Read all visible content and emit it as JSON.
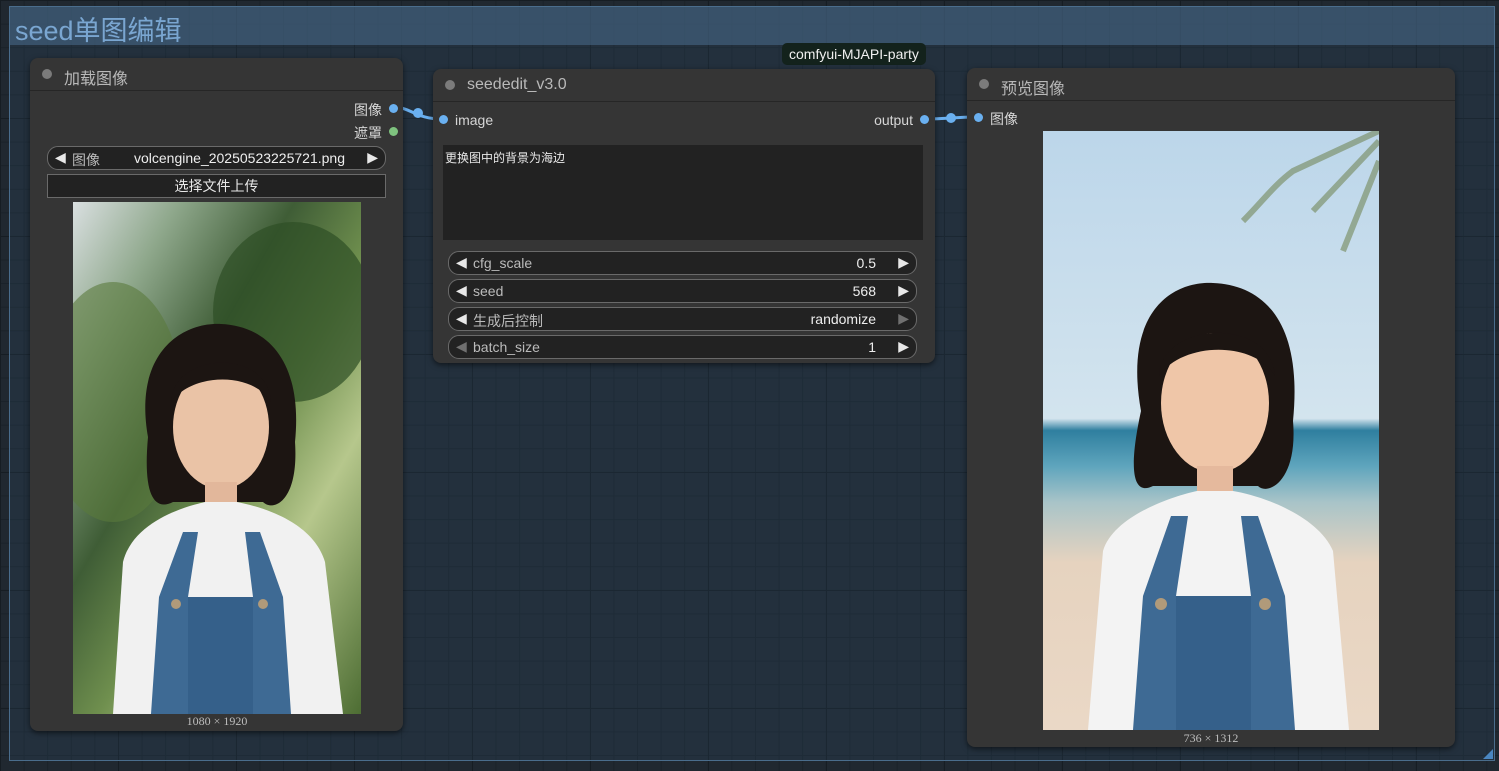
{
  "group": {
    "title": "seed单图编辑"
  },
  "badge": "comfyui-MJAPI-party",
  "load_image_node": {
    "title": "加载图像",
    "outputs": [
      "图像",
      "遮罩"
    ],
    "image_combo": {
      "label": "图像",
      "value": "volcengine_20250523225721.png"
    },
    "upload_label": "选择文件上传",
    "image_size": "1080 × 1920",
    "photo": "girl-in-denim-overalls-garden-background"
  },
  "seededit_node": {
    "title": "seededit_v3.0",
    "input_label": "image",
    "output_label": "output",
    "prompt": "更换图中的背景为海边",
    "widgets": [
      {
        "label": "cfg_scale",
        "value": "0.5"
      },
      {
        "label": "seed",
        "value": "568"
      },
      {
        "label": "生成后控制",
        "value": "randomize"
      },
      {
        "label": "batch_size",
        "value": "1"
      }
    ]
  },
  "preview_node": {
    "title": "预览图像",
    "input_label": "图像",
    "image_size": "736 × 1312",
    "photo": "girl-in-denim-overalls-beach-background"
  },
  "colors": {
    "image_slot": "#6ab0f0",
    "mask_slot": "#7ec27e",
    "link": "#6ab0f0",
    "group_title": "#7aa6d1"
  }
}
